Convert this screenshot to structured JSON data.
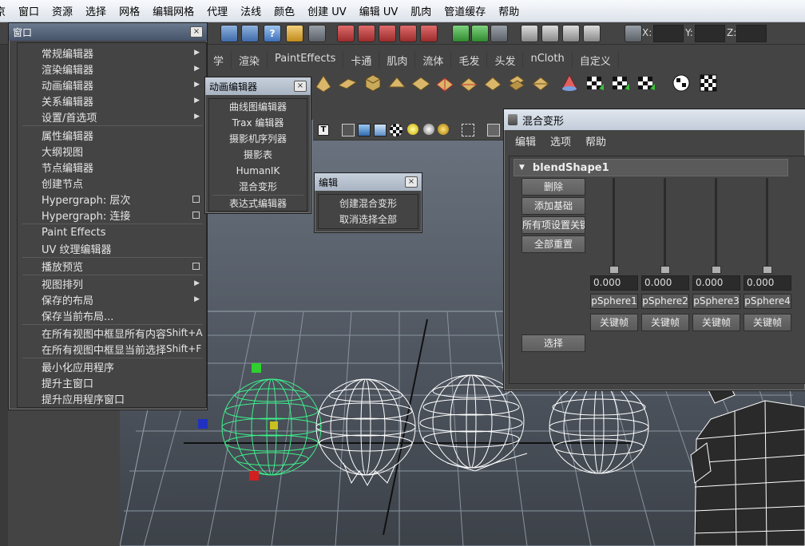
{
  "menubar": {
    "items": [
      "京",
      "窗口",
      "资源",
      "选择",
      "网格",
      "编辑网格",
      "代理",
      "法线",
      "颜色",
      "创建 UV",
      "编辑 UV",
      "肌肉",
      "管道缓存",
      "帮助"
    ]
  },
  "status_line": {
    "x_label": "X:",
    "y_label": "Y:",
    "z_label": "Z:"
  },
  "shelf": {
    "tabs": [
      "学",
      "渲染",
      "PaintEffects",
      "卡通",
      "肌肉",
      "流体",
      "毛发",
      "头发",
      "nCloth",
      "自定义"
    ]
  },
  "window_menu": {
    "title": "窗口",
    "items": [
      {
        "label": "常规编辑器",
        "type": "submenu"
      },
      {
        "label": "渲染编辑器",
        "type": "submenu"
      },
      {
        "label": "动画编辑器",
        "type": "submenu"
      },
      {
        "label": "关系编辑器",
        "type": "submenu"
      },
      {
        "label": "设置/首选项",
        "type": "submenu"
      },
      {
        "label": "属性编辑器",
        "type": "plain"
      },
      {
        "label": "大纲视图",
        "type": "plain"
      },
      {
        "label": "节点编辑器",
        "type": "plain"
      },
      {
        "label": "创建节点",
        "type": "plain"
      },
      {
        "label": "Hypergraph: 层次",
        "type": "option"
      },
      {
        "label": "Hypergraph: 连接",
        "type": "option"
      },
      {
        "label": "Paint Effects",
        "type": "plain"
      },
      {
        "label": "UV 纹理编辑器",
        "type": "plain"
      },
      {
        "label": "播放预览",
        "type": "option"
      },
      {
        "label": "视图排列",
        "type": "submenu"
      },
      {
        "label": "保存的布局",
        "type": "submenu"
      },
      {
        "label": "保存当前布局...",
        "type": "plain"
      },
      {
        "label": "在所有视图中框显所有内容",
        "shortcut": "Shift+A",
        "type": "plain"
      },
      {
        "label": "在所有视图中框显当前选择",
        "shortcut": "Shift+F",
        "type": "plain"
      },
      {
        "label": "最小化应用程序",
        "type": "plain"
      },
      {
        "label": "提升主窗口",
        "type": "plain"
      },
      {
        "label": "提升应用程序窗口",
        "type": "plain"
      }
    ]
  },
  "anim_editors_menu": {
    "title": "动画编辑器",
    "items": [
      "曲线图编辑器",
      "Trax 编辑器",
      "摄影机序列器",
      "摄影表",
      "HumanIK",
      "混合变形",
      "表达式编辑器"
    ]
  },
  "edit_menu": {
    "title": "编辑",
    "items": [
      "创建混合变形",
      "取消选择全部"
    ]
  },
  "blend_window": {
    "title": "混合变形",
    "menu": [
      "编辑",
      "选项",
      "帮助"
    ],
    "node_name": "blendShape1",
    "buttons": {
      "delete": "删除",
      "add_base": "添加基础",
      "set_key_all": "所有项设置关键",
      "reset_all": "全部重置",
      "select": "选择"
    },
    "targets": [
      {
        "weight": "0.000",
        "name": "pSphere1",
        "key_label": "关键帧"
      },
      {
        "weight": "0.000",
        "name": "pSphere2",
        "key_label": "关键帧"
      },
      {
        "weight": "0.000",
        "name": "pSphere3",
        "key_label": "关键帧"
      },
      {
        "weight": "0.000",
        "name": "pSphere4",
        "key_label": "关键帧"
      }
    ]
  },
  "colors": {
    "panel": "#444444",
    "selection_green": "#3ef08c",
    "wire_white": "#ffffff",
    "title_blue": "#46546a"
  }
}
